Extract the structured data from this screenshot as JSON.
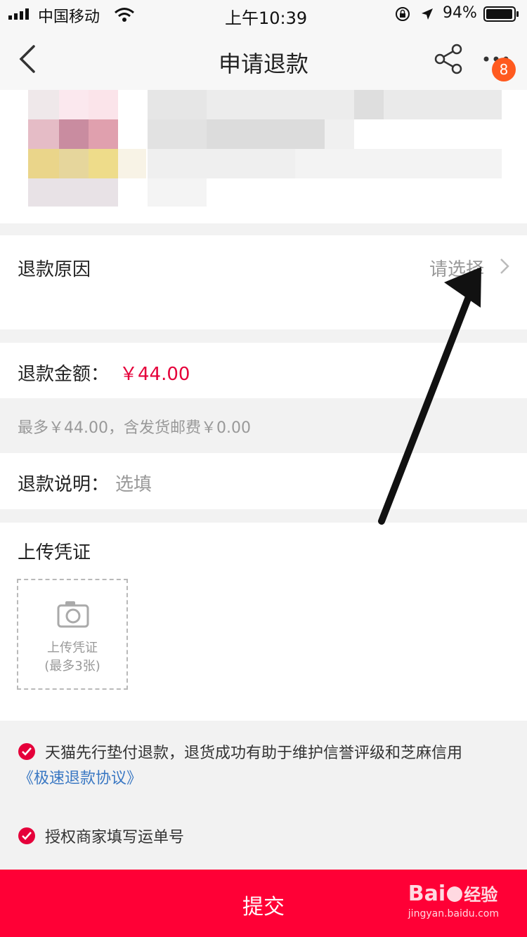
{
  "status_bar": {
    "carrier": "中国移动",
    "time": "上午10:39",
    "battery": "94%",
    "icons": [
      "signal-icon",
      "wifi-icon",
      "rotation-lock-icon",
      "location-icon",
      "battery-icon"
    ]
  },
  "nav": {
    "title": "申请退款",
    "badge_count": "8",
    "icons": [
      "back-chevron-icon",
      "share-icon",
      "more-icon"
    ]
  },
  "refund_reason": {
    "label": "退款原因",
    "value": "请选择"
  },
  "refund_amount": {
    "label": "退款金额：",
    "amount": "￥44.00",
    "max_note": "最多￥44.00，含发货邮费￥0.00"
  },
  "refund_description": {
    "label": "退款说明：",
    "placeholder": "选填"
  },
  "upload": {
    "title": "上传凭证",
    "box_line1": "上传凭证",
    "box_line2": "(最多3张)"
  },
  "agreements": [
    {
      "text": "天猫先行垫付退款，退货成功有助于维护信誉评级和芝麻信用",
      "link": "《极速退款协议》"
    },
    {
      "text": "授权商家填写运单号"
    }
  ],
  "submit_label": "提交",
  "watermark": {
    "brand": "Bai",
    "cn": "经验",
    "url": "jingyan.baidu.com"
  },
  "colors": {
    "accent": "#ff0036",
    "price": "#e5003a",
    "link": "#3a78c3",
    "badge": "#ff5a1f"
  }
}
